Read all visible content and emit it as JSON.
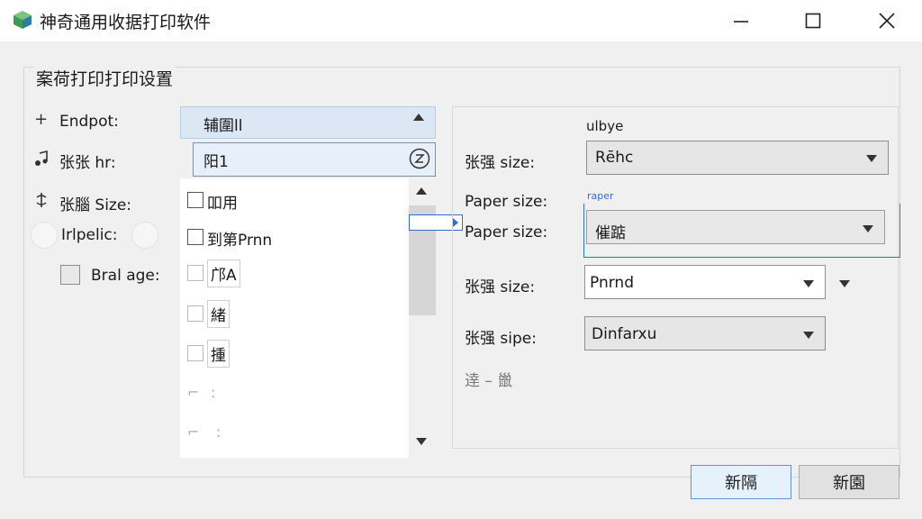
{
  "window": {
    "title": "神奇通用收据打印软件",
    "minimize_icon": "minimize-icon",
    "maximize_icon": "maximize-icon",
    "close_icon": "close-icon"
  },
  "group": {
    "title": "案荷打印打印设置"
  },
  "left": {
    "endpot_label": "Endpot:",
    "row2_label": "张张  hr:",
    "row3_label": "张腦 Size:",
    "radio_label": "Irlpelic:",
    "checkbox_label": "Bral age:"
  },
  "dropdown": {
    "header": "辅圍ll",
    "field_value": "阳1",
    "items": [
      {
        "label": "吅用"
      },
      {
        "label": "到第Prnn"
      },
      {
        "label": "邝A"
      },
      {
        "label": "緒"
      },
      {
        "label": "揰"
      },
      {
        "label": ":"
      },
      {
        "label": ":"
      }
    ]
  },
  "right": {
    "top_label": "ulbye",
    "row1_label": "张强 size:",
    "row1_value": "Rēhc",
    "paper_label_a": "Paper size:",
    "small_label": "raper",
    "paper_label_b": "Paper size:",
    "paper_value": "催踮",
    "row3_label": "张强 size:",
    "row3_value": "Pnrnd",
    "row4_label": "张强 sipe:",
    "row4_value": "Dinfarxu",
    "footer_text": "逹 – 巤"
  },
  "buttons": {
    "ok": "新隔",
    "cancel": "新園"
  },
  "colors": {
    "accent": "#2f6fd0",
    "selection": "#dbe7f4",
    "background": "#f0f0f0"
  }
}
